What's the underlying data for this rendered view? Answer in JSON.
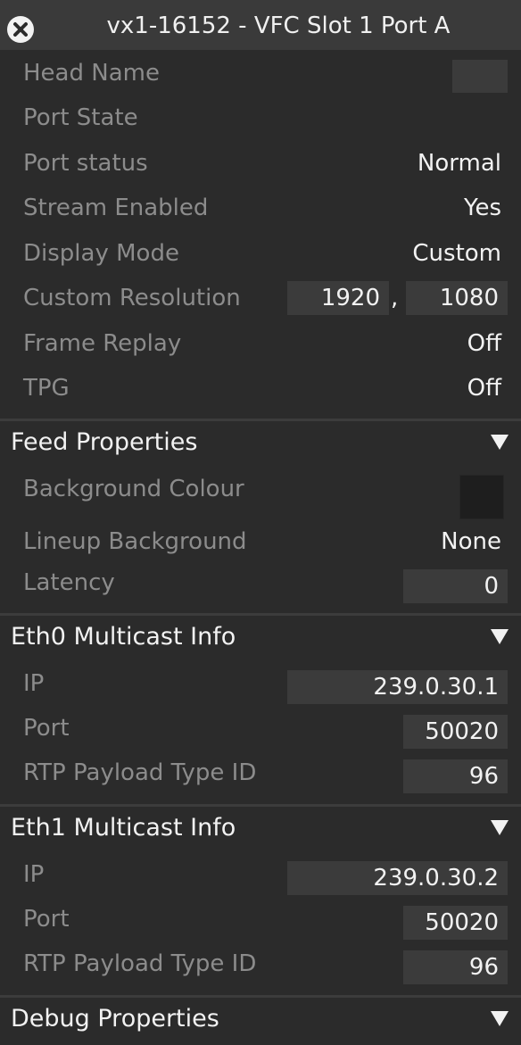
{
  "window": {
    "title": "vx1-16152 - VFC Slot 1 Port A"
  },
  "port": {
    "head_name_label": "Head Name",
    "port_state_label": "Port State",
    "port_status_label": "Port status",
    "port_status_value": "Normal",
    "stream_enabled_label": "Stream Enabled",
    "stream_enabled_value": "Yes",
    "display_mode_label": "Display Mode",
    "display_mode_value": "Custom",
    "custom_resolution_label": "Custom Resolution",
    "resolution_width": "1920",
    "resolution_separator": ",",
    "resolution_height": "1080",
    "frame_replay_label": "Frame Replay",
    "frame_replay_value": "Off",
    "tpg_label": "TPG",
    "tpg_value": "Off"
  },
  "feed": {
    "title": "Feed Properties",
    "background_colour_label": "Background Colour",
    "background_colour_value": "#1e1e1e",
    "lineup_background_label": "Lineup Background",
    "lineup_background_value": "None",
    "latency_label": "Latency",
    "latency_value": "0"
  },
  "eth0": {
    "title": "Eth0 Multicast Info",
    "ip_label": "IP",
    "ip_value": "239.0.30.1",
    "port_label": "Port",
    "port_value": "50020",
    "rtp_label": "RTP Payload Type ID",
    "rtp_value": "96"
  },
  "eth1": {
    "title": "Eth1 Multicast Info",
    "ip_label": "IP",
    "ip_value": "239.0.30.2",
    "port_label": "Port",
    "port_value": "50020",
    "rtp_label": "RTP Payload Type ID",
    "rtp_value": "96"
  },
  "debug": {
    "title": "Debug Properties"
  },
  "icons": {
    "close": "close-icon",
    "expand": "triangle-down-icon"
  }
}
